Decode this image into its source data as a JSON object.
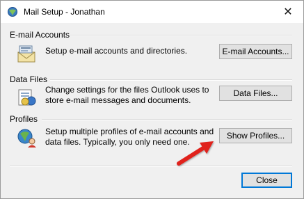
{
  "window": {
    "title": "Mail Setup - Jonathan",
    "close_symbol": "✕"
  },
  "sections": {
    "email": {
      "label": "E-mail Accounts",
      "description": "Setup e-mail accounts and directories.",
      "button_label": "E-mail Accounts...",
      "icon": "mail-accounts-icon"
    },
    "datafiles": {
      "label": "Data Files",
      "description": "Change settings for the files Outlook uses to store e-mail messages and documents.",
      "button_label": "Data Files...",
      "icon": "data-files-icon"
    },
    "profiles": {
      "label": "Profiles",
      "description": "Setup multiple profiles of e-mail accounts and data files. Typically, you only need one.",
      "button_label": "Show Profiles...",
      "icon": "profiles-icon"
    }
  },
  "footer": {
    "close_label": "Close"
  },
  "annotation": {
    "arrow_color": "#e0201b"
  }
}
